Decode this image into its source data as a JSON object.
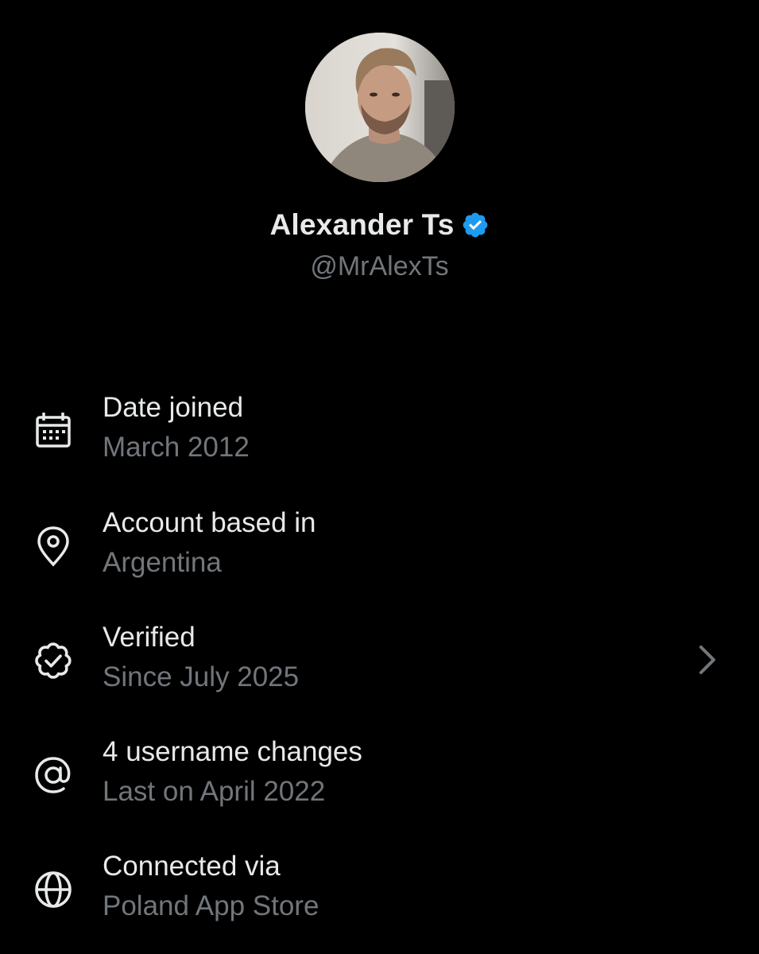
{
  "profile": {
    "display_name": "Alexander Ts",
    "handle": "@MrAlexTs",
    "verified": true
  },
  "colors": {
    "background": "#000000",
    "primary_text": "#e7e9ea",
    "secondary_text": "#71767b",
    "verified_blue": "#1d9bf0"
  },
  "info_items": [
    {
      "icon": "calendar-icon",
      "title": "Date joined",
      "value": "March 2012"
    },
    {
      "icon": "location-pin-icon",
      "title": "Account based in",
      "value": "Argentina"
    },
    {
      "icon": "verified-badge-icon",
      "title": "Verified",
      "value": "Since July 2025",
      "has_chevron": true
    },
    {
      "icon": "at-sign-icon",
      "title": "4 username changes",
      "value": "Last on April 2022"
    },
    {
      "icon": "globe-icon",
      "title": "Connected via",
      "value": "Poland App Store"
    }
  ]
}
